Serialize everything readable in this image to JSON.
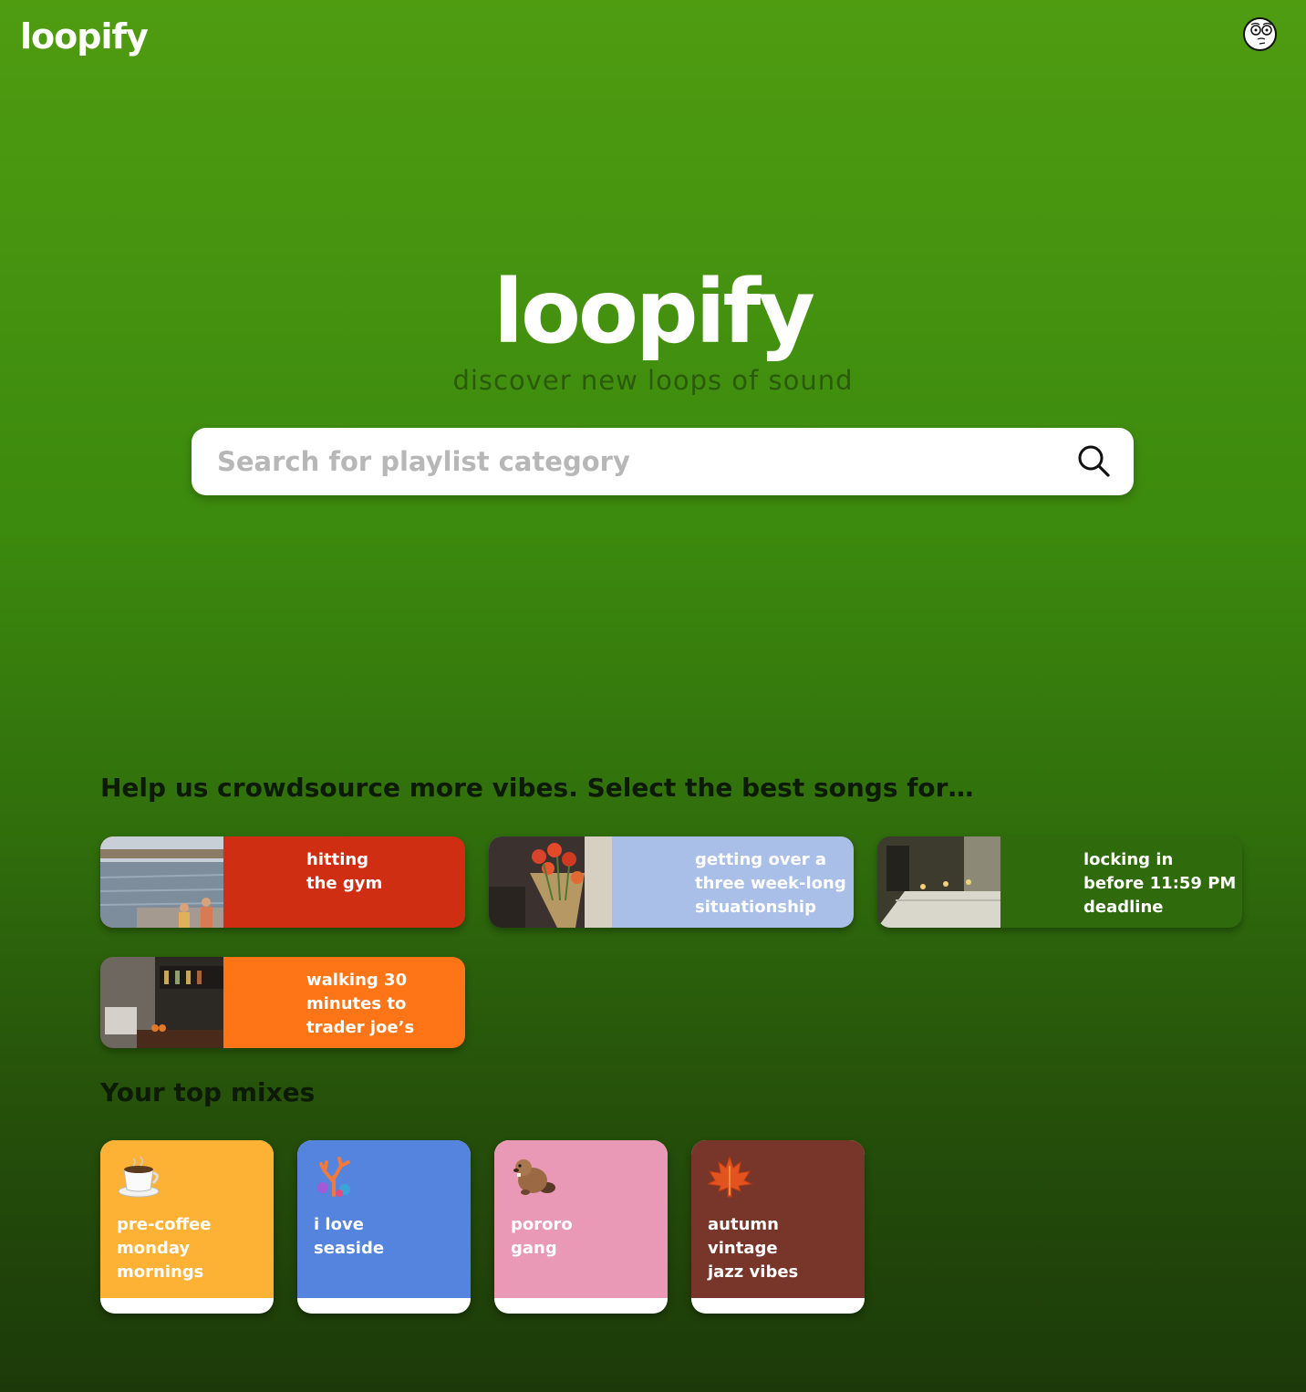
{
  "header": {
    "logo": "loopify",
    "avatar_icon": "meme-face-avatar-icon"
  },
  "hero": {
    "title": "loopify",
    "subtitle": "discover new loops of sound"
  },
  "search": {
    "placeholder": "Search for playlist category",
    "icon": "search-icon"
  },
  "crowdsource": {
    "title": "Help us crowdsource more vibes. Select the best songs for…",
    "cards": [
      {
        "label": "hitting\nthe gym",
        "color": "#cf2e13",
        "image": "seaside-promenade-photo"
      },
      {
        "label": "getting over a\nthree week-long\nsituationship",
        "color": "#aabfe8",
        "image": "tulip-bouquet-photo"
      },
      {
        "label": "locking in\nbefore 11:59 PM\ndeadline",
        "color": "#2f6b0c",
        "image": "candlelit-dinner-table-photo"
      },
      {
        "label": "walking 30\nminutes to\ntrader joe’s",
        "color": "#fd7516",
        "image": "cafe-bar-photo"
      }
    ]
  },
  "mixes": {
    "title": "Your top mixes",
    "items": [
      {
        "label": "pre-coffee\nmonday\nmornings",
        "color": "#fdb236",
        "icon": "coffee-cup-icon"
      },
      {
        "label": "i love\nseaside",
        "color": "#5584de",
        "icon": "coral-icon"
      },
      {
        "label": "pororo\ngang",
        "color": "#e999b5",
        "icon": "beaver-icon"
      },
      {
        "label": "autumn\nvintage\njazz vibes",
        "color": "#78362b",
        "icon": "maple-leaf-icon"
      }
    ]
  }
}
